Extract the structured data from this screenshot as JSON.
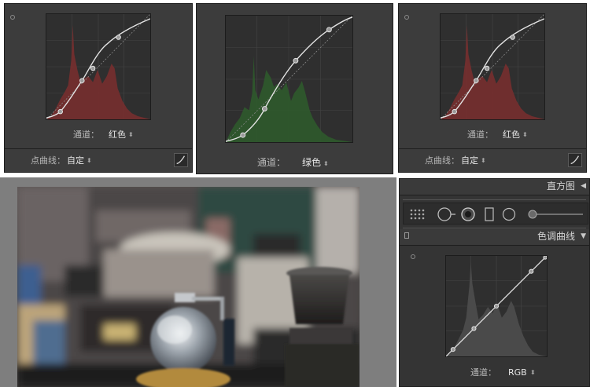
{
  "top_panels": [
    {
      "channel_label": "通道：",
      "channel_value": "红色",
      "point_curve_label": "点曲线：",
      "point_curve_value": "自定",
      "histogram_color": "#7a2e2e"
    },
    {
      "channel_label": "通道：",
      "channel_value": "绿色",
      "histogram_color": "#2f5a2c"
    },
    {
      "channel_label": "通道：",
      "channel_value": "红色",
      "point_curve_label": "点曲线：",
      "point_curve_value": "自定",
      "histogram_color": "#7a2e2e"
    }
  ],
  "histogram_panel": {
    "title": "直方图"
  },
  "tone_curve_panel": {
    "title": "色调曲线",
    "channel_label": "通道：",
    "channel_value": "RGB"
  },
  "colors": {
    "panel_bg": "#3c3c3c",
    "plot_bg": "#2f2f2f",
    "curve": "#e4e4e4"
  },
  "icons": [
    "target-icon",
    "curve-edit-icon",
    "grid-icon",
    "crop-tool-icon",
    "spot-removal-icon",
    "red-eye-icon",
    "graduated-filter-icon",
    "radial-filter-icon",
    "adjustment-brush-icon"
  ]
}
